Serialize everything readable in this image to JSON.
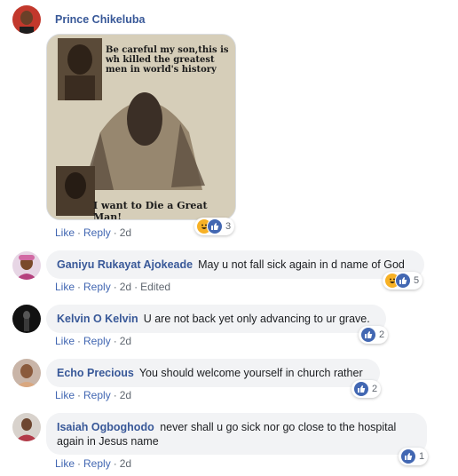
{
  "comments": [
    {
      "name": "Prince Chikeluba",
      "text": "",
      "image": {
        "caption_top": "Be careful my son,this is wh killed the greatest men in world's history",
        "caption_bottom": "I want to Die a Great Man!"
      },
      "like_label": "Like",
      "reply_label": "Reply",
      "time": "2d",
      "edited": "",
      "reaction_count": "3",
      "reactions": [
        "haha-icon",
        "like-icon"
      ]
    },
    {
      "name": "Ganiyu Rukayat Ajokeade",
      "text": "May u not fall sick again in d name of God",
      "like_label": "Like",
      "reply_label": "Reply",
      "time": "2d",
      "edited": "Edited",
      "reaction_count": "5",
      "reactions": [
        "haha-icon",
        "like-icon"
      ]
    },
    {
      "name": "Kelvin O Kelvin",
      "text": "U are not back yet only advancing to ur grave.",
      "like_label": "Like",
      "reply_label": "Reply",
      "time": "2d",
      "reaction_count": "2",
      "reactions": [
        "like-icon"
      ]
    },
    {
      "name": "Echo Precious",
      "text": "You should welcome yourself in church rather",
      "like_label": "Like",
      "reply_label": "Reply",
      "time": "2d",
      "reaction_count": "2",
      "reactions": [
        "like-icon"
      ]
    },
    {
      "name": "Isaiah Ogboghodo",
      "text": "never shall u go sick nor go close to the hospital again in Jesus name",
      "like_label": "Like",
      "reply_label": "Reply",
      "time": "2d",
      "reaction_count": "1",
      "reactions": [
        "like-icon"
      ]
    }
  ],
  "colors": {
    "name": "#385898",
    "link": "#4267b2",
    "bubble": "#f2f3f5",
    "like": "#4267b2",
    "haha": "#f7b125"
  }
}
